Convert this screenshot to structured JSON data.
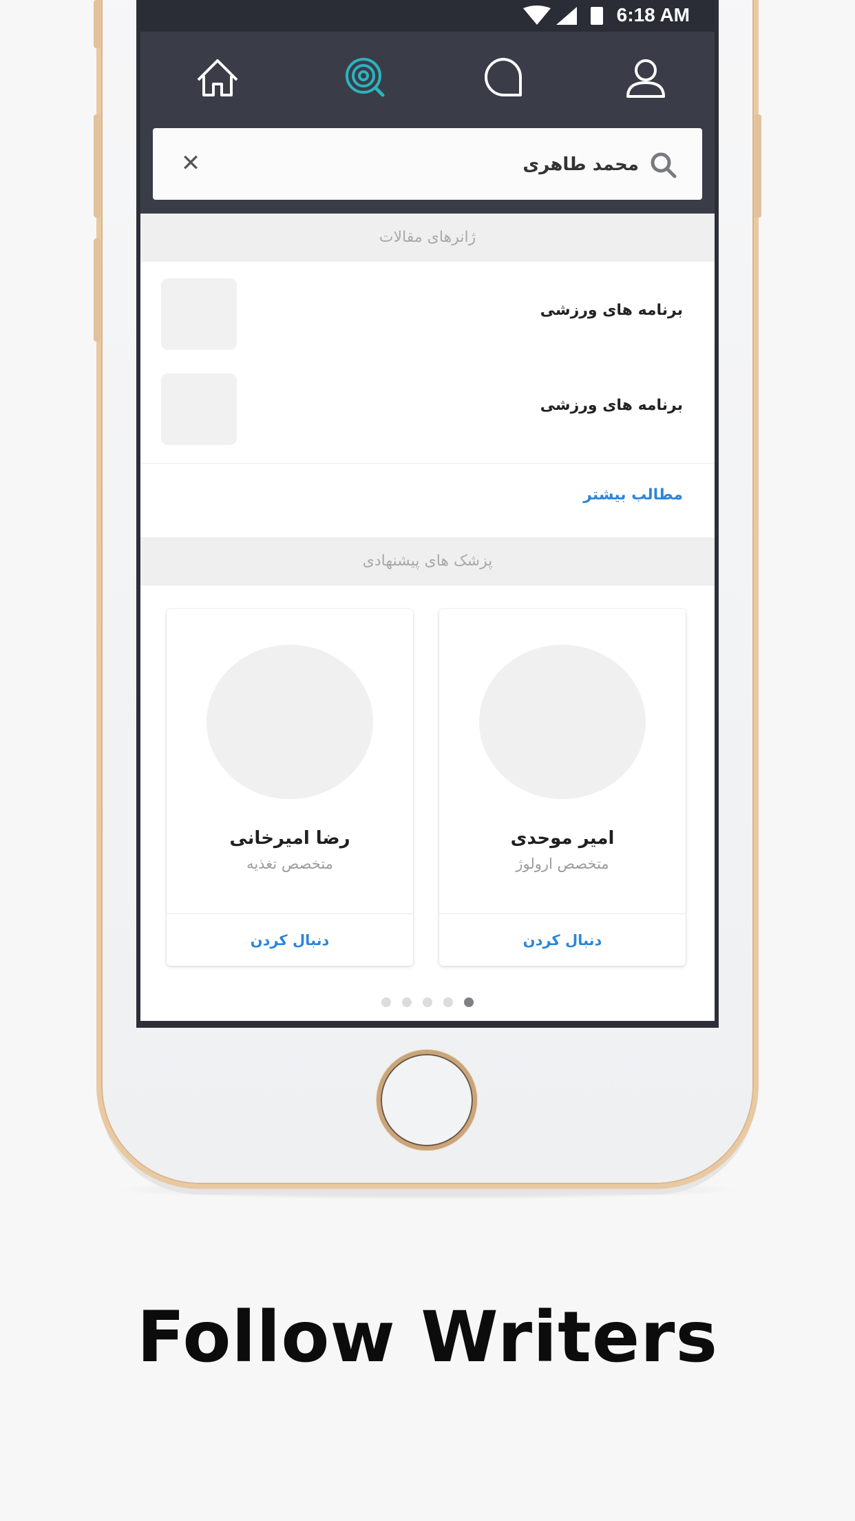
{
  "status_bar": {
    "time": "6:18 AM"
  },
  "nav": {
    "items": [
      {
        "name": "home",
        "active": false
      },
      {
        "name": "discover",
        "active": true
      },
      {
        "name": "chat",
        "active": false
      },
      {
        "name": "profile",
        "active": false
      }
    ],
    "active_color": "#2bb3c0"
  },
  "search": {
    "value": "محمد طاهری"
  },
  "genres_section": {
    "title": "ژانرهای مقالات",
    "items": [
      {
        "label": "برنامه های ورزشی"
      },
      {
        "label": "برنامه های ورزشی"
      }
    ],
    "more_label": "مطالب بیشتر"
  },
  "doctors_section": {
    "title": "پزشک های پیشنهادی",
    "cards": [
      {
        "name": "امیر موحدی",
        "specialty": "متخصص ارولوژ",
        "follow_label": "دنبال کردن"
      },
      {
        "name": "رضا امیرخانی",
        "specialty": "متخصص تغذیه",
        "follow_label": "دنبال کردن"
      }
    ]
  },
  "pagination": {
    "count": 5,
    "active_index": 4
  },
  "caption": "Follow Writers",
  "colors": {
    "link": "#2d86d8",
    "nav_bg": "#3a3d47",
    "status_bg": "#2a2d36",
    "frame_gold": "#e9c9a2"
  }
}
